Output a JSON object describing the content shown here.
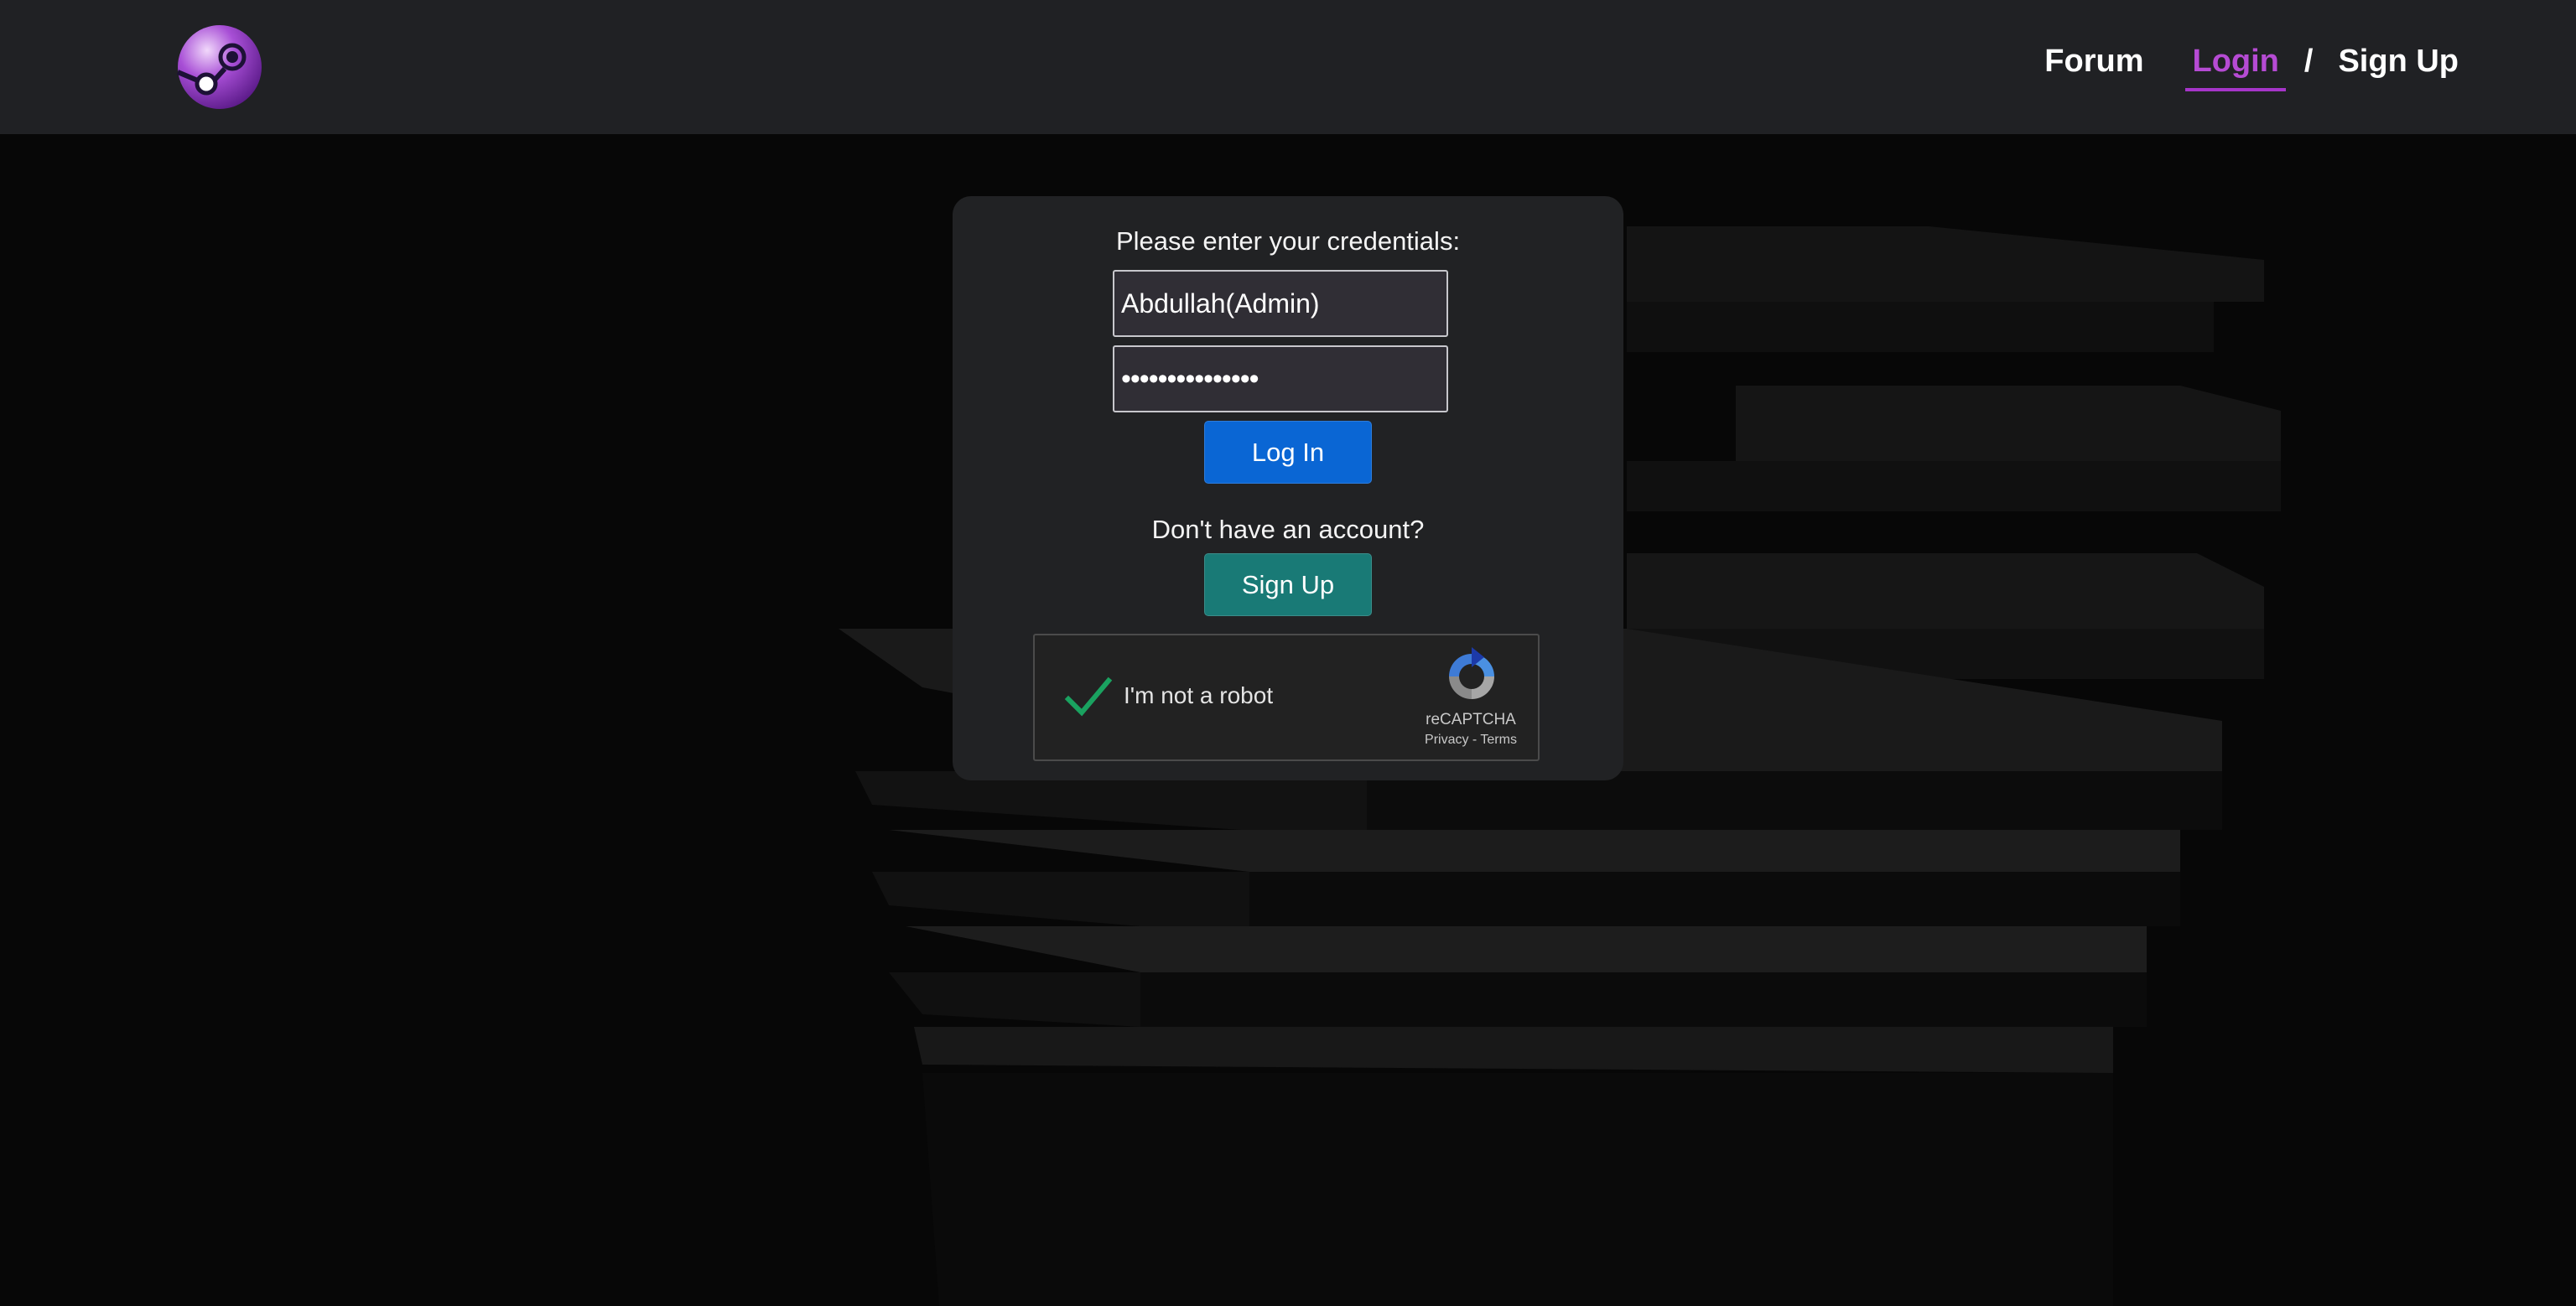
{
  "navbar": {
    "logo_icon": "steam-logo-icon",
    "links": {
      "forum": "Forum",
      "login": "Login",
      "separator": "/",
      "signup": "Sign Up"
    },
    "active_color": "#b64bd4"
  },
  "login_card": {
    "prompt": "Please enter your credentials:",
    "username_value": "Abdullah(Admin)",
    "password_value": "•••••••••••••••",
    "login_button": "Log In",
    "signup_prompt": "Don't have an account?",
    "signup_button": "Sign Up"
  },
  "captcha": {
    "label": "I'm not a robot",
    "brand": "reCAPTCHA",
    "privacy": "Privacy",
    "link_separator": " - ",
    "terms": "Terms",
    "checked": true,
    "check_icon": "checkmark-icon",
    "logo_icon": "recaptcha-logo-icon"
  },
  "colors": {
    "navbar_bg": "#202124",
    "card_bg": "#212224",
    "login_button": "#0a66d4",
    "signup_button": "#197a76",
    "check": "#1aa260"
  }
}
